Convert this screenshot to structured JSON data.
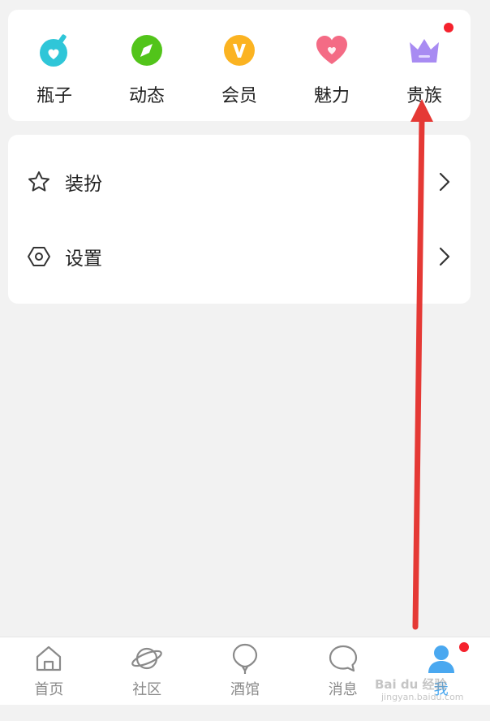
{
  "quick_access": {
    "items": [
      {
        "label": "瓶子",
        "icon": "bottle-icon",
        "color": "#2fc6d8"
      },
      {
        "label": "动态",
        "icon": "compass-icon",
        "color": "#52c41a"
      },
      {
        "label": "会员",
        "icon": "vip-icon",
        "color": "#fbb321"
      },
      {
        "label": "魅力",
        "icon": "heart-icon",
        "color": "#f46b85"
      },
      {
        "label": "贵族",
        "icon": "crown-icon",
        "color": "#a88bf2"
      }
    ]
  },
  "menu": {
    "items": [
      {
        "label": "装扮",
        "icon": "star-icon"
      },
      {
        "label": "设置",
        "icon": "hexagon-settings-icon"
      }
    ]
  },
  "tabbar": {
    "tabs": [
      {
        "label": "首页",
        "icon": "home-icon"
      },
      {
        "label": "社区",
        "icon": "planet-icon"
      },
      {
        "label": "酒馆",
        "icon": "balloon-icon"
      },
      {
        "label": "消息",
        "icon": "chat-bubble-icon"
      },
      {
        "label": "我",
        "icon": "avatar-icon",
        "active_color": "#4aa8f0"
      }
    ]
  },
  "colors": {
    "badge": "#f5222d",
    "annotation_arrow": "#e53935"
  },
  "watermark": {
    "text": "Bai du 经验",
    "sub": "jingyan.baidu.com"
  }
}
